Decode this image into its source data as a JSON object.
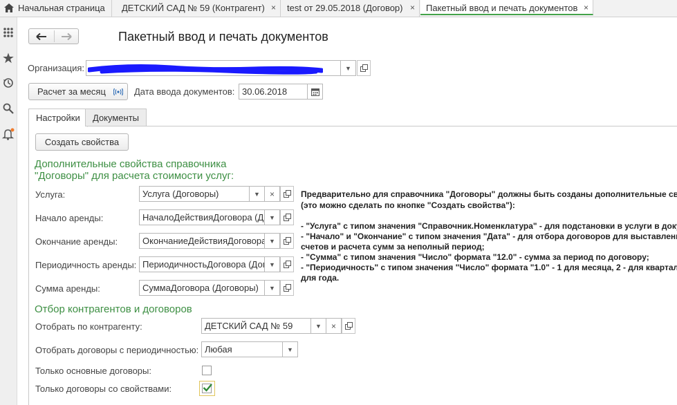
{
  "tabs": [
    {
      "label": "Начальная страница",
      "closable": false
    },
    {
      "label": "ДЕТСКИЙ САД № 59 (Контрагент)",
      "closable": true
    },
    {
      "label": "test от 29.05.2018 (Договор)",
      "closable": true
    },
    {
      "label": "Пакетный ввод и печать документов",
      "closable": true,
      "active": true
    }
  ],
  "close_glyph": "×",
  "form": {
    "title": "Пакетный ввод и печать документов",
    "org_label": "Организация:",
    "org_value": "",
    "calc_button": "Расчет за месяц",
    "date_label": "Дата ввода документов:",
    "date_value": "30.06.2018",
    "form_tabs": [
      "Настройки",
      "Документы"
    ],
    "create_props_button": "Создать свойства",
    "section1_line1": "Дополнительные свойства справочника",
    "section1_line2": "\"Договоры\" для расчета стоимости услуг:",
    "props": [
      {
        "label": "Услуга:",
        "value": "Услуга (Договоры)"
      },
      {
        "label": "Начало аренды:",
        "value": "НачалоДействияДоговора (Дог"
      },
      {
        "label": "Окончание аренды:",
        "value": "ОкончаниеДействияДоговора"
      },
      {
        "label": "Периодичность аренды:",
        "value": "ПериодичностьДоговора (Дог"
      },
      {
        "label": "Сумма аренды:",
        "value": "СуммаДоговора (Договоры)"
      }
    ],
    "description": [
      "Предварительно для справочника \"Договоры\" должны быть созданы дополнительные све",
      "(это можно сделать по кнопке \"Создать свойства\"):",
      "",
      "  - \"Услуга\" с типом значения \"Справочник.Номенклатура\" - для подстановки в услуги в доку",
      "  - \"Начало\" и \"Окончание\" с типом значения \"Дата\" - для отбора договоров для выставлени",
      "счетов и расчета сумм за неполный период;",
      "  - \"Сумма\" с типом значения \"Число\" формата \"12.0\" - сумма за период по договору;",
      "  - \"Периодичность\" с типом значения \"Число\" формата \"1.0\" - 1 для месяца, 2 - для квартал",
      "для года."
    ],
    "section2": "Отбор контрагентов и договоров",
    "contractor_label": "Отобрать по контрагенту:",
    "contractor_value": "ДЕТСКИЙ САД № 59",
    "period_label": "Отобрать договоры с периодичностью:",
    "period_value": "Любая",
    "main_only_label": "Только основные договоры:",
    "main_only_checked": false,
    "with_props_label": "Только договоры со свойствами:",
    "with_props_checked": true
  },
  "colors": {
    "accent": "#3d8f43",
    "redaction": "#1a1aff"
  }
}
